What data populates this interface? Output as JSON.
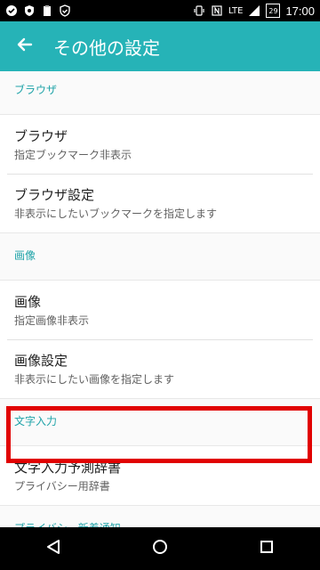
{
  "status_bar": {
    "left_icons": [
      "check-circle-icon",
      "shield-icon",
      "clipboard-icon",
      "shield-check-icon"
    ],
    "network": "LTE",
    "battery_level": "29",
    "time": "17:00"
  },
  "app_bar": {
    "title": "その他の設定"
  },
  "sections": [
    {
      "header": "ブラウザ",
      "items": [
        {
          "title": "ブラウザ",
          "subtitle": "指定ブックマーク非表示"
        },
        {
          "title": "ブラウザ設定",
          "subtitle": "非表示にしたいブックマークを指定します"
        }
      ]
    },
    {
      "header": "画像",
      "items": [
        {
          "title": "画像",
          "subtitle": "指定画像非表示"
        },
        {
          "title": "画像設定",
          "subtitle": "非表示にしたい画像を指定します"
        }
      ]
    },
    {
      "header": "文字入力",
      "items": [
        {
          "title": "文字入力予測辞書",
          "subtitle": "プライバシー用辞書"
        }
      ]
    },
    {
      "header": "プライバシー新着通知"
    }
  ],
  "colors": {
    "accent": "#26b3b7",
    "section_header": "#1fa3a8",
    "highlight": "#e10000"
  }
}
